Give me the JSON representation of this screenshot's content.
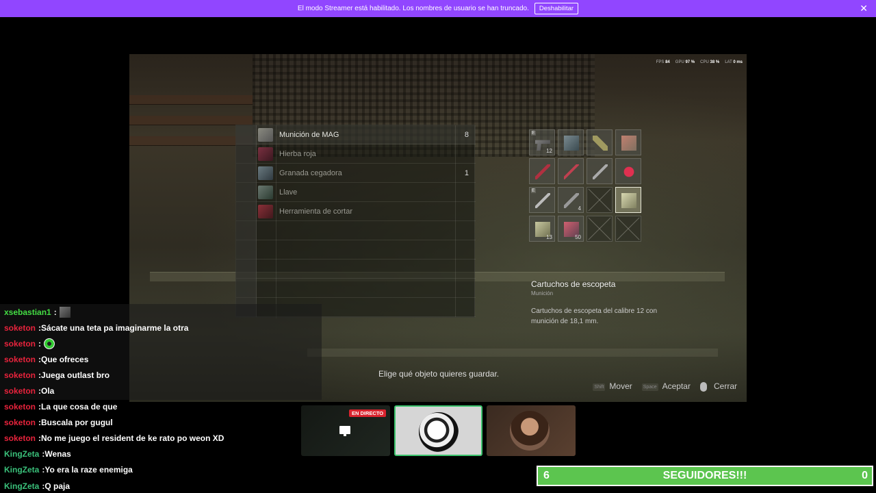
{
  "banner": {
    "text": "El modo Streamer está habilitado. Los nombres de usuario se han truncado.",
    "button": "Deshabilitar",
    "close": "✕"
  },
  "hud": {
    "fps_label": "FPS",
    "fps": "84",
    "gpu_label": "GPU",
    "gpu": "97 %",
    "cpu_label": "CPU",
    "cpu": "38 %",
    "lat_label": "LAT",
    "lat": "0 ms"
  },
  "items": [
    {
      "name": "Munición de MAG",
      "qty": "8"
    },
    {
      "name": "Hierba roja",
      "qty": ""
    },
    {
      "name": "Granada cegadora",
      "qty": "1"
    },
    {
      "name": "Llave",
      "qty": ""
    },
    {
      "name": "Herramienta de cortar",
      "qty": ""
    }
  ],
  "grid": {
    "c0_tag": "E",
    "c0_num": "12",
    "c8_tag": "E",
    "c9_num": "4",
    "c12_num": "13",
    "c13_num": "50"
  },
  "description": {
    "title": "Cartuchos de escopeta",
    "subtitle": "Munición",
    "body": "Cartuchos de escopeta del calibre 12 con munición de 18,1 mm."
  },
  "prompt": "Elige qué objeto quieres guardar.",
  "controls": {
    "move_key": "Shift",
    "move": "Mover",
    "accept_key": "Space",
    "accept": "Aceptar",
    "close": "Cerrar"
  },
  "chat": [
    {
      "user": "xsebastian1",
      "color": "#44dd44",
      "text": ""
    },
    {
      "user": "soketon",
      "color": "#e8233c",
      "text": "Sácate una teta pa imaginarme la otra"
    },
    {
      "user": "soketon",
      "color": "#e8233c",
      "text": ""
    },
    {
      "user": "soketon",
      "color": "#e8233c",
      "text": "Que ofreces"
    },
    {
      "user": "soketon",
      "color": "#e8233c",
      "text": "Juega outlast bro"
    },
    {
      "user": "soketon",
      "color": "#e8233c",
      "text": "Ola"
    },
    {
      "user": "soketon",
      "color": "#e8233c",
      "text": "La que cosa de que"
    },
    {
      "user": "soketon",
      "color": "#e8233c",
      "text": "Buscala por gugul"
    },
    {
      "user": "soketon",
      "color": "#e8233c",
      "text": "No me juego el resident de ke rato po weon XD"
    },
    {
      "user": "KingZeta",
      "color": "#3ac07a",
      "text": "Wenas"
    },
    {
      "user": "KingZeta",
      "color": "#3ac07a",
      "text": "Yo era la raze enemiga"
    },
    {
      "user": "KingZeta",
      "color": "#3ac07a",
      "text": "Q paja"
    }
  ],
  "cams": {
    "live": "EN DIRECTO"
  },
  "followers": {
    "current": "6",
    "label": "SEGUIDORES!!!",
    "goal": "0"
  }
}
